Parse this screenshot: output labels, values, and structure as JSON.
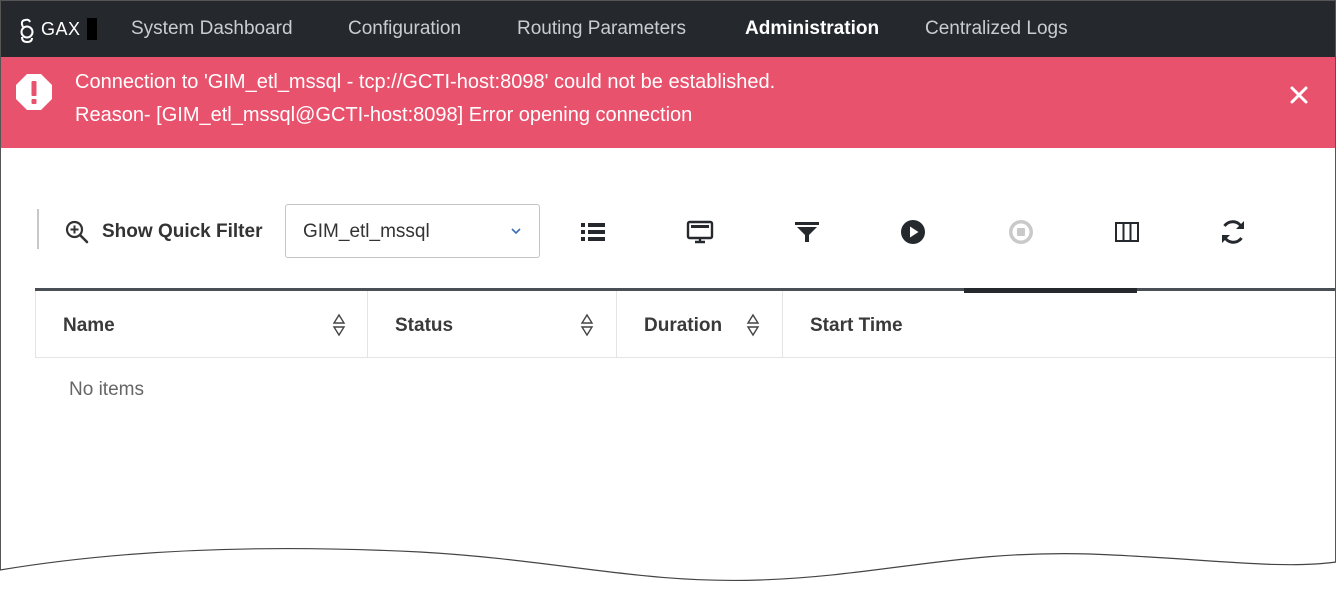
{
  "app": {
    "brand": "GAX",
    "nav": [
      {
        "label": "System Dashboard",
        "active": false
      },
      {
        "label": "Configuration",
        "active": false
      },
      {
        "label": "Routing Parameters",
        "active": false
      },
      {
        "label": "Administration",
        "active": true
      },
      {
        "label": "Centralized Logs",
        "active": false
      }
    ]
  },
  "alert": {
    "line1": "Connection to 'GIM_etl_mssql - tcp://GCTI-host:8098' could not be established.",
    "line2": "Reason- [GIM_etl_mssql@GCTI-host:8098] Error opening connection",
    "icon": "exclamation-icon",
    "color": "#e8526d"
  },
  "toolbar": {
    "quick_filter_label": "Show Quick Filter",
    "selected_app": "GIM_etl_mssql",
    "tools": [
      "list-icon",
      "monitor-icon",
      "filter-icon",
      "play-icon",
      "stop-icon",
      "columns-icon",
      "refresh-icon"
    ]
  },
  "table": {
    "columns": [
      "Name",
      "Status",
      "Duration",
      "Start Time"
    ],
    "empty_text": "No items"
  },
  "colors": {
    "nav_bg": "#25292e",
    "alert_bg": "#e8526d"
  }
}
